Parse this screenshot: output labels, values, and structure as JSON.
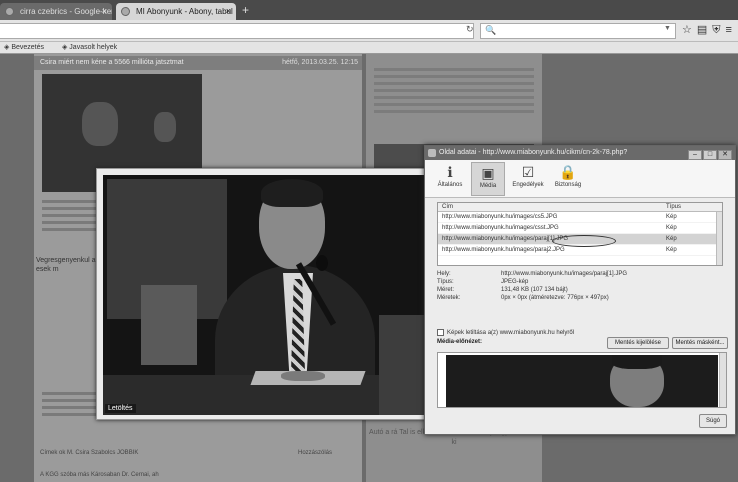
{
  "tabs": [
    {
      "title": "cirra czebrics - Google-kere",
      "active": false
    },
    {
      "title": "MI Abonyunk - Abony, tabul",
      "active": true
    }
  ],
  "bookmarks": [
    "Bevezetés",
    "Javasolt helyek"
  ],
  "page": {
    "article_title": "Csira miért nem kéne a 5566 millióta jatsztmat",
    "article_date": "hétfő, 2013.03.25. 12:15",
    "article_heading2": "Vegresgenyenkul a PDESZ-esek m",
    "bottom_row_left": "Címek ok M. Csira Szabolcs   JOBBIK",
    "bottom_row_right": "Hozzászólás",
    "bottom_row2": "A KGG szóba más Károsaban Dr. Cernai, ah",
    "ad_text": "Autó a rá Tal is elkáldó forbolni vida kinyongyik kollánis ki"
  },
  "viewer": {
    "caption": "Letöltés"
  },
  "dialog": {
    "title": "Oldal adatai - http://www.miabonyunk.hu/cikm/cn-2k-78.php?",
    "toolbar": [
      {
        "label": "Általános",
        "icon": "info-icon"
      },
      {
        "label": "Média",
        "icon": "media-icon",
        "selected": true
      },
      {
        "label": "Engedélyek",
        "icon": "permissions-icon"
      },
      {
        "label": "Biztonság",
        "icon": "lock-icon"
      }
    ],
    "list_headers": {
      "address": "Cím",
      "type": "Típus"
    },
    "list_rows": [
      {
        "url": "http://www.miabonyunk.hu/images/cs5.JPG",
        "type": "Kép",
        "selected": false
      },
      {
        "url": "http://www.miabonyunk.hu/images/csst.JPG",
        "type": "Kép",
        "selected": false
      },
      {
        "url": "http://www.miabonyunk.hu/images/paraj[1].JPG",
        "type": "Kép",
        "selected": true
      },
      {
        "url": "http://www.miabonyunk.hu/images/paraj2.JPG",
        "type": "Kép",
        "selected": false
      }
    ],
    "info": [
      {
        "key": "Hely:",
        "value": "http://www.miabonyunk.hu/images/paraj[1].JPG"
      },
      {
        "key": "Típus:",
        "value": "JPEG-kép"
      },
      {
        "key": "Méret:",
        "value": "131,48 KB (107 134 bájt)"
      },
      {
        "key": "Méretek:",
        "value": "0px × 0px (átméretezve: 776px × 497px)"
      }
    ],
    "block_label": "Képek letiltása a(z) www.miabonyunk.hu helyről",
    "preview_label": "Média-előnézet:",
    "show_button": "Mentés kijelölése",
    "saveas_button": "Mentés másként...",
    "help_button": "Súgó"
  },
  "colors": {
    "dialog_bg": "#ececec",
    "selected_row": "#d3d3d3"
  }
}
